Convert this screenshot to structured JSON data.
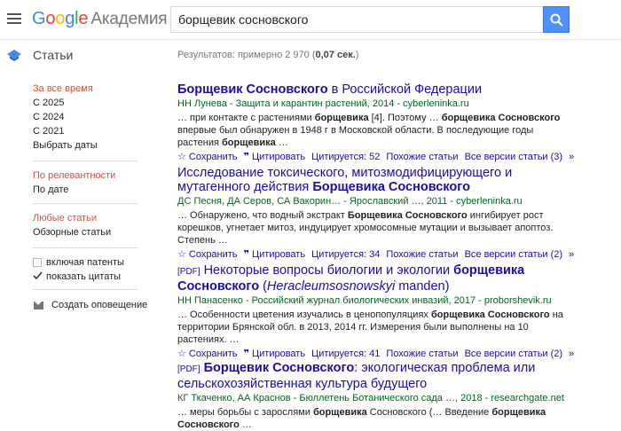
{
  "header": {
    "logo_google": "Google",
    "logo_academy": "Академия",
    "search_value": "борщевик сосновского"
  },
  "subheader": {
    "title": "Статьи",
    "results_prefix": "Результатов: примерно 2 970 (",
    "results_time": "0,07 сек.",
    "results_suffix": ")"
  },
  "sidebar": {
    "time_any": "За все время",
    "since_2025": "С 2025",
    "since_2024": "С 2024",
    "since_2021": "С 2021",
    "choose_dates": "Выбрать даты",
    "sort_relevance": "По релевантности",
    "sort_date": "По дате",
    "any_type": "Любые статьи",
    "review": "Обзорные статьи",
    "include_patents": "включая патенты",
    "show_citations": "показать цитаты",
    "create_alert": "Создать оповещение"
  },
  "results": [
    {
      "pdf": "",
      "title_parts": [
        [
          "Борщевик Сосновского",
          true
        ],
        [
          " в Российской Федерации",
          false
        ]
      ],
      "authors": "НН Лунева - Защита и карантин растений, 2014 - cyberleninka.ru",
      "snippet_parts": [
        [
          "… при контакте с растениями ",
          false
        ],
        [
          "борщевика",
          true
        ],
        [
          " [4]. Поэтому … ",
          false
        ],
        [
          "борщевика Сосновского",
          true
        ],
        [
          " впервые был обнаружен в 1948 г в Московской области. В последующие годы растения ",
          false
        ],
        [
          "борщевика",
          true
        ],
        [
          " …",
          false
        ]
      ],
      "save": "Сохранить",
      "cite": "Цитировать",
      "cited_by": "Цитируется: 52",
      "related": "Похожие статьи",
      "versions": "Все версии статьи (3)"
    },
    {
      "pdf": "",
      "title_parts": [
        [
          "Исследование токсического, митозмодифицирующего и мутагенного действия ",
          false
        ],
        [
          "Борщевика Сосновского",
          true
        ]
      ],
      "authors": "ДС Песня, ДА Серов, СА Вакорин… - Ярославский …, 2011 - cyberleninka.ru",
      "snippet_parts": [
        [
          "… Обнаружено, что водный экстракт ",
          false
        ],
        [
          "Борщевика Сосновского",
          true
        ],
        [
          " ингибирует рост корешков, угнетает митоз, индуцирует хромосомные мутации и вызывает апоптоз. Степень …",
          false
        ]
      ],
      "save": "Сохранить",
      "cite": "Цитировать",
      "cited_by": "Цитируется: 34",
      "related": "Похожие статьи",
      "versions": "Все версии статьи (2)"
    },
    {
      "pdf": "[PDF]",
      "title_parts": [
        [
          "Некоторые вопросы биологии и экологии ",
          false
        ],
        [
          "борщевика Сосновского",
          true
        ],
        [
          " (",
          false
        ],
        [
          "Heracleumsosnowskyi",
          "i"
        ],
        [
          " manden)",
          false
        ]
      ],
      "authors": "НН Панасенко - Российский журнал биологических инвазий, 2017 - proborshevik.ru",
      "snippet_parts": [
        [
          "… Особенности цветения изучались в ценопопуляциях ",
          false
        ],
        [
          "борщевика Сосновского",
          true
        ],
        [
          " на территории Брянской обл. в 2013, 2014 гг. Измерения были выполнены на 10 растениях. …",
          false
        ]
      ],
      "save": "Сохранить",
      "cite": "Цитировать",
      "cited_by": "Цитируется: 41",
      "related": "Похожие статьи",
      "versions": "Все версии статьи (2)"
    },
    {
      "pdf": "[PDF]",
      "title_parts": [
        [
          "Борщевик Сосновского",
          true
        ],
        [
          ": экологическая проблема или сельскохозяйственная культура будущего",
          false
        ]
      ],
      "authors": "КГ Ткаченко, АА Краснов - Бюллетень Ботанического сада …, 2018 - researchgate.net",
      "snippet_parts": [
        [
          "… меры борьбы с зарослями ",
          false
        ],
        [
          "борщевика",
          true
        ],
        [
          " Сосновского (… Введение ",
          false
        ],
        [
          "борщевика Сосновского",
          true
        ],
        [
          " …",
          false
        ]
      ],
      "save": "",
      "cite": "",
      "cited_by": "",
      "related": "",
      "versions": ""
    }
  ],
  "colors": {
    "link": "#1a0dab",
    "author_green": "#006621",
    "active_red": "#dd4b39",
    "search_blue": "#4d90fe"
  }
}
